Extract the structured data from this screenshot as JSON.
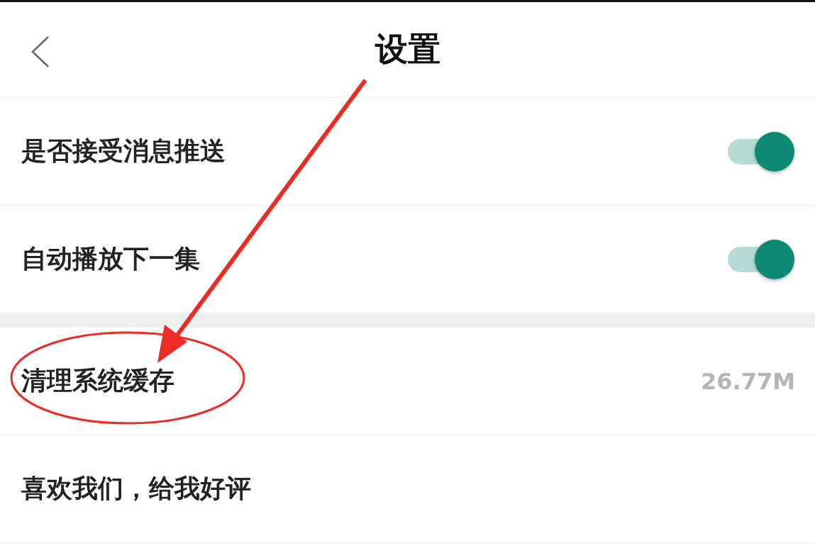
{
  "header": {
    "title": "设置"
  },
  "sections": [
    {
      "rows": [
        {
          "kind": "toggle",
          "label": "是否接受消息推送",
          "on": true
        },
        {
          "kind": "toggle",
          "label": "自动播放下一集",
          "on": true
        }
      ]
    },
    {
      "rows": [
        {
          "kind": "value",
          "label": "清理系统缓存",
          "value": "26.77M"
        },
        {
          "kind": "plain",
          "label": "喜欢我们，给我好评"
        }
      ]
    }
  ],
  "annotations": {
    "arrow": true,
    "ellipse": true
  }
}
